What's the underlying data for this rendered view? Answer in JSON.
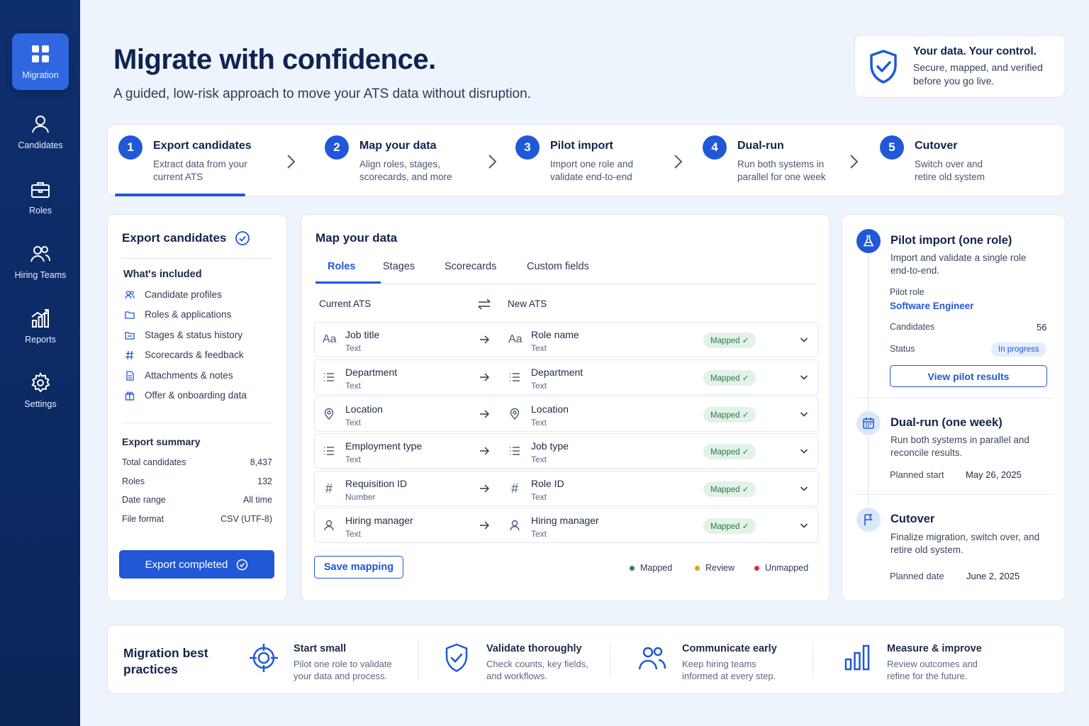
{
  "sidebar": {
    "items": [
      {
        "label": "Migration",
        "icon": "grid-icon",
        "active": true
      },
      {
        "label": "Candidates",
        "icon": "user-icon"
      },
      {
        "label": "Roles",
        "icon": "briefcase-icon"
      },
      {
        "label": "Hiring Teams",
        "icon": "users-icon"
      },
      {
        "label": "Reports",
        "icon": "chart-icon"
      },
      {
        "label": "Settings",
        "icon": "gear-icon"
      }
    ]
  },
  "header": {
    "title": "Migrate with confidence.",
    "subtitle": "A guided, low-risk approach to move your ATS data without disruption."
  },
  "trust": {
    "title": "Your data. Your control.",
    "desc": "Secure, mapped, and verified before you go live."
  },
  "steps": [
    {
      "num": "1",
      "title": "Export candidates",
      "desc": "Extract data from your current ATS"
    },
    {
      "num": "2",
      "title": "Map your data",
      "desc": "Align roles, stages, scorecards, and more"
    },
    {
      "num": "3",
      "title": "Pilot import",
      "desc": "Import one role and validate end-to-end"
    },
    {
      "num": "4",
      "title": "Dual-run",
      "desc": "Run both systems in parallel for one week"
    },
    {
      "num": "5",
      "title": "Cutover",
      "desc": "Switch over and retire old system"
    }
  ],
  "export": {
    "title": "Export candidates",
    "included_heading": "What's included",
    "included": [
      "Candidate profiles",
      "Roles & applications",
      "Stages & status history",
      "Scorecards & feedback",
      "Attachments & notes",
      "Offer & onboarding data"
    ],
    "summary_heading": "Export summary",
    "summary": [
      {
        "label": "Total candidates",
        "value": "8,437"
      },
      {
        "label": "Roles",
        "value": "132"
      },
      {
        "label": "Date range",
        "value": "All time"
      },
      {
        "label": "File format",
        "value": "CSV (UTF-8)"
      }
    ],
    "button": "Export completed"
  },
  "map": {
    "title": "Map your data",
    "tabs": [
      "Roles",
      "Stages",
      "Scorecards",
      "Custom fields"
    ],
    "current_label": "Current ATS",
    "new_label": "New ATS",
    "rows": [
      {
        "src": "Job title",
        "src_type": "Text",
        "src_icon": "Aa",
        "dst": "Role name",
        "dst_type": "Text",
        "dst_icon": "Aa",
        "status": "Mapped ✓"
      },
      {
        "src": "Department",
        "src_type": "Text",
        "src_icon": "list",
        "dst": "Department",
        "dst_type": "Text",
        "dst_icon": "list",
        "status": "Mapped ✓"
      },
      {
        "src": "Location",
        "src_type": "Text",
        "src_icon": "pin",
        "dst": "Location",
        "dst_type": "Text",
        "dst_icon": "pin",
        "status": "Mapped ✓"
      },
      {
        "src": "Employment type",
        "src_type": "Text",
        "src_icon": "list",
        "dst": "Job type",
        "dst_type": "Text",
        "dst_icon": "list",
        "status": "Mapped ✓"
      },
      {
        "src": "Requisition ID",
        "src_type": "Number",
        "src_icon": "#",
        "dst": "Role ID",
        "dst_type": "Text",
        "dst_icon": "#",
        "status": "Mapped ✓"
      },
      {
        "src": "Hiring manager",
        "src_type": "Text",
        "src_icon": "user",
        "dst": "Hiring manager",
        "dst_type": "Text",
        "dst_icon": "user",
        "status": "Mapped ✓"
      }
    ],
    "save_button": "Save mapping",
    "legend": [
      {
        "label": "Mapped",
        "color": "#2a8a4a"
      },
      {
        "label": "Review",
        "color": "#e0a020"
      },
      {
        "label": "Unmapped",
        "color": "#d9303a"
      }
    ]
  },
  "pilot": {
    "title": "Pilot import (one role)",
    "desc": "Import and validate a single role end-to-end.",
    "role_label": "Pilot role",
    "role_value": "Software Engineer",
    "candidates_label": "Candidates",
    "candidates_value": "56",
    "status_label": "Status",
    "status_value": "In progress",
    "button": "View pilot results"
  },
  "dualrun": {
    "title": "Dual-run (one week)",
    "desc": "Run both systems in parallel and reconcile results.",
    "start_label": "Planned start",
    "start_value": "May 26, 2025"
  },
  "cutover": {
    "title": "Cutover",
    "desc": "Finalize migration, switch over, and retire old system.",
    "date_label": "Planned date",
    "date_value": "June 2, 2025"
  },
  "best_practices": {
    "title": "Migration best practices",
    "items": [
      {
        "title": "Start small",
        "desc": "Pilot one role to validate your data and process."
      },
      {
        "title": "Validate thoroughly",
        "desc": "Check counts, key fields, and workflows."
      },
      {
        "title": "Communicate early",
        "desc": "Keep hiring teams informed at every step."
      },
      {
        "title": "Measure & improve",
        "desc": "Review outcomes and refine for the future."
      }
    ]
  },
  "colors": {
    "accent": "#2158d6",
    "sidebar": "#0e2f6e",
    "mapped_bg": "#e2f2e8"
  }
}
